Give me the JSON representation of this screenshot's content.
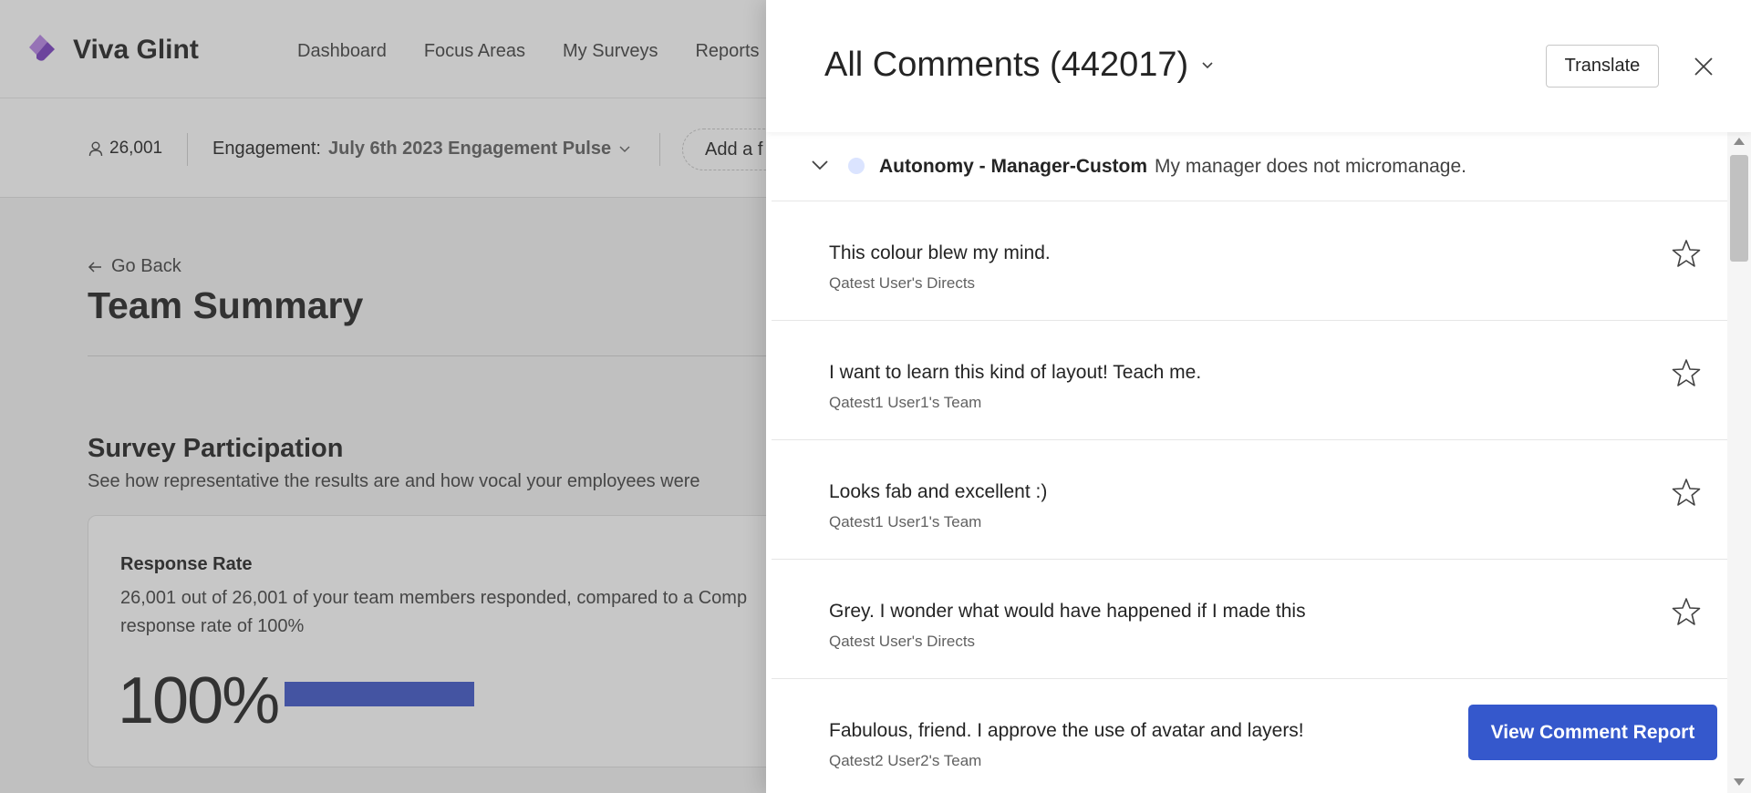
{
  "app": {
    "brand": "Viva Glint",
    "nav": [
      "Dashboard",
      "Focus Areas",
      "My Surveys",
      "Reports"
    ]
  },
  "filters": {
    "members": "26,001",
    "engagement_label": "Engagement:",
    "engagement_value": "July 6th 2023 Engagement Pulse",
    "add_filter": "Add a f"
  },
  "page": {
    "go_back": "Go Back",
    "title": "Team Summary",
    "section_title": "Survey Participation",
    "section_subtitle": "See how representative the results are and how vocal your employees were",
    "card": {
      "title": "Response Rate",
      "description": "26,001 out of 26,001 of your team members responded, compared to a Comp response rate of 100%",
      "big_value": "100%",
      "progress": 1.0
    }
  },
  "panel": {
    "title": "All Comments (442017)",
    "translate": "Translate",
    "question": {
      "name": "Autonomy - Manager-Custom",
      "text": "My manager does not micromanage."
    },
    "comments": [
      {
        "text": "This colour blew my mind.",
        "group": "Qatest User's Directs"
      },
      {
        "text": "I want to learn this kind of layout! Teach me.",
        "group": "Qatest1 User1's Team"
      },
      {
        "text": "Looks fab and excellent :)",
        "group": "Qatest1 User1's Team"
      },
      {
        "text": "Grey. I wonder what would have happened if I made this",
        "group": "Qatest User's Directs"
      },
      {
        "text": "Fabulous, friend. I approve the use of avatar and layers!",
        "group": "Qatest2 User2's Team"
      }
    ],
    "view_report": "View Comment Report"
  },
  "colors": {
    "accent": "#3558cc",
    "brand_purple": "#8a4fd3",
    "progress_bar": "#3f56c9"
  }
}
